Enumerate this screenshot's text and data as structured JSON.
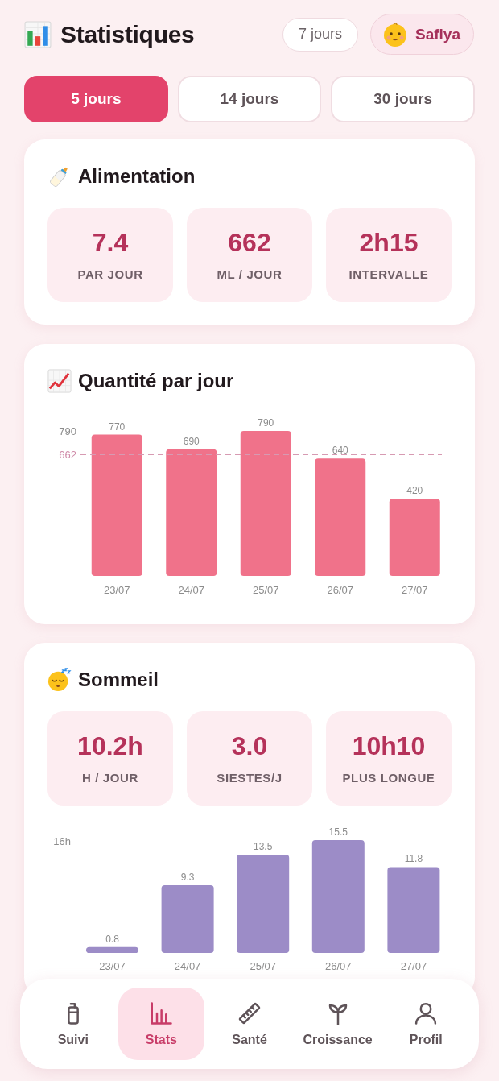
{
  "header": {
    "title": "Statistiques",
    "badge": "7 jours",
    "profile_name": "Safiya"
  },
  "period_tabs": [
    {
      "label": "5 jours",
      "selected": true
    },
    {
      "label": "14 jours",
      "selected": false
    },
    {
      "label": "30 jours",
      "selected": false
    }
  ],
  "feeding": {
    "title": "Alimentation",
    "stats": [
      {
        "value": "7.4",
        "label": "PAR JOUR"
      },
      {
        "value": "662",
        "label": "ML / JOUR"
      },
      {
        "value": "2h15",
        "label": "INTERVALLE"
      }
    ]
  },
  "quantity": {
    "title": "Quantité par jour",
    "chart_data": {
      "type": "bar",
      "categories": [
        "23/07",
        "24/07",
        "25/07",
        "26/07",
        "27/07"
      ],
      "values": [
        770,
        690,
        790,
        640,
        420
      ],
      "data_labels": true,
      "annotations": [
        "790"
      ],
      "ref_lines": [
        {
          "axis": "y",
          "value": 662,
          "label": "662"
        }
      ]
    }
  },
  "sleep": {
    "title": "Sommeil",
    "stats": [
      {
        "value": "10.2h",
        "label": "H / JOUR"
      },
      {
        "value": "3.0",
        "label": "SIESTES/J"
      },
      {
        "value": "10h10",
        "label": "PLUS LONGUE"
      }
    ],
    "chart_data": {
      "type": "bar",
      "categories": [
        "23/07",
        "24/07",
        "25/07",
        "26/07",
        "27/07"
      ],
      "values": [
        0.8,
        9.3,
        13.5,
        15.5,
        11.8
      ],
      "data_labels": true,
      "annotations": [
        "16h"
      ]
    }
  },
  "bottom_nav": [
    {
      "label": "Suivi",
      "selected": false
    },
    {
      "label": "Stats",
      "selected": true
    },
    {
      "label": "Santé",
      "selected": false
    },
    {
      "label": "Croissance",
      "selected": false
    },
    {
      "label": "Profil",
      "selected": false
    }
  ]
}
